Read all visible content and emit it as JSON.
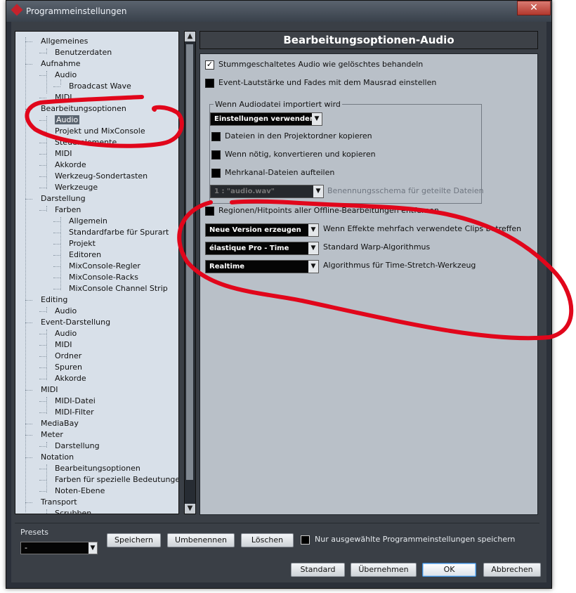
{
  "window": {
    "title": "Programmeinstellungen",
    "close_symbol": "✕"
  },
  "tree": {
    "items": [
      {
        "label": "Allgemeines"
      },
      {
        "label": "Benutzerdaten"
      },
      {
        "label": "Aufnahme"
      },
      {
        "label": "Audio"
      },
      {
        "label": "Broadcast Wave"
      },
      {
        "label": "MIDI"
      },
      {
        "label": "Bearbeitungsoptionen"
      },
      {
        "label": "Audio"
      },
      {
        "label": "Projekt und MixConsole"
      },
      {
        "label": "Steuerelemente"
      },
      {
        "label": "MIDI"
      },
      {
        "label": "Akkorde"
      },
      {
        "label": "Werkzeug-Sondertasten"
      },
      {
        "label": "Werkzeuge"
      },
      {
        "label": "Darstellung"
      },
      {
        "label": "Farben"
      },
      {
        "label": "Allgemein"
      },
      {
        "label": "Standardfarbe für Spurart"
      },
      {
        "label": "Projekt"
      },
      {
        "label": "Editoren"
      },
      {
        "label": "MixConsole-Regler"
      },
      {
        "label": "MixConsole-Racks"
      },
      {
        "label": "MixConsole Channel Strip"
      },
      {
        "label": "Editing"
      },
      {
        "label": "Audio"
      },
      {
        "label": "Event-Darstellung"
      },
      {
        "label": "Audio"
      },
      {
        "label": "MIDI"
      },
      {
        "label": "Ordner"
      },
      {
        "label": "Spuren"
      },
      {
        "label": "Akkorde"
      },
      {
        "label": "MIDI"
      },
      {
        "label": "MIDI-Datei"
      },
      {
        "label": "MIDI-Filter"
      },
      {
        "label": "MediaBay"
      },
      {
        "label": "Meter"
      },
      {
        "label": "Darstellung"
      },
      {
        "label": "Notation"
      },
      {
        "label": "Bearbeitungsoptionen"
      },
      {
        "label": "Farben für spezielle Bedeutungen"
      },
      {
        "label": "Noten-Ebene"
      },
      {
        "label": "Transport"
      },
      {
        "label": "Scrubben"
      }
    ]
  },
  "main": {
    "title": "Bearbeitungsoptionen-Audio",
    "options": [
      {
        "label": "Stummgeschaltetes Audio wie gelöschtes behandeln",
        "checked": true
      },
      {
        "label": "Event-Lautstärke und Fades mit dem Mausrad einstellen",
        "checked": false
      }
    ],
    "import_group": {
      "label": "Wenn Audiodatei importiert wird",
      "select_value": "Einstellungen verwenden",
      "options": [
        {
          "label": "Dateien in den Projektordner kopieren",
          "checked": false
        },
        {
          "label": "Wenn nötig, konvertieren und kopieren",
          "checked": false
        },
        {
          "label": "Mehrkanal-Dateien aufteilen",
          "checked": false
        }
      ],
      "naming_select": "1 : \"audio.wav\"",
      "naming_label": "Benennungsschema für geteilte Dateien"
    },
    "regions_option": {
      "label": "Regionen/Hitpoints aller Offline-Bearbeitungen entfernen",
      "checked": false
    },
    "selects": [
      {
        "value": "Neue Version erzeugen",
        "label": "Wenn Effekte mehrfach verwendete Clips betreffen"
      },
      {
        "value": "élastique Pro - Time",
        "label": "Standard Warp-Algorithmus"
      },
      {
        "value": "Realtime",
        "label": "Algorithmus für Time-Stretch-Werkzeug"
      }
    ]
  },
  "presets": {
    "label": "Presets",
    "value": "-",
    "save_label": "Speichern",
    "rename_label": "Umbenennen",
    "delete_label": "Löschen",
    "only_selected_label": "Nur ausgewählte Programmeinstellungen speichern"
  },
  "footer": {
    "standard_label": "Standard",
    "apply_label": "Übernehmen",
    "ok_label": "OK",
    "cancel_label": "Abbrechen"
  },
  "colors": {
    "annotation": "#e1061b",
    "accent": "#3a86d0"
  }
}
